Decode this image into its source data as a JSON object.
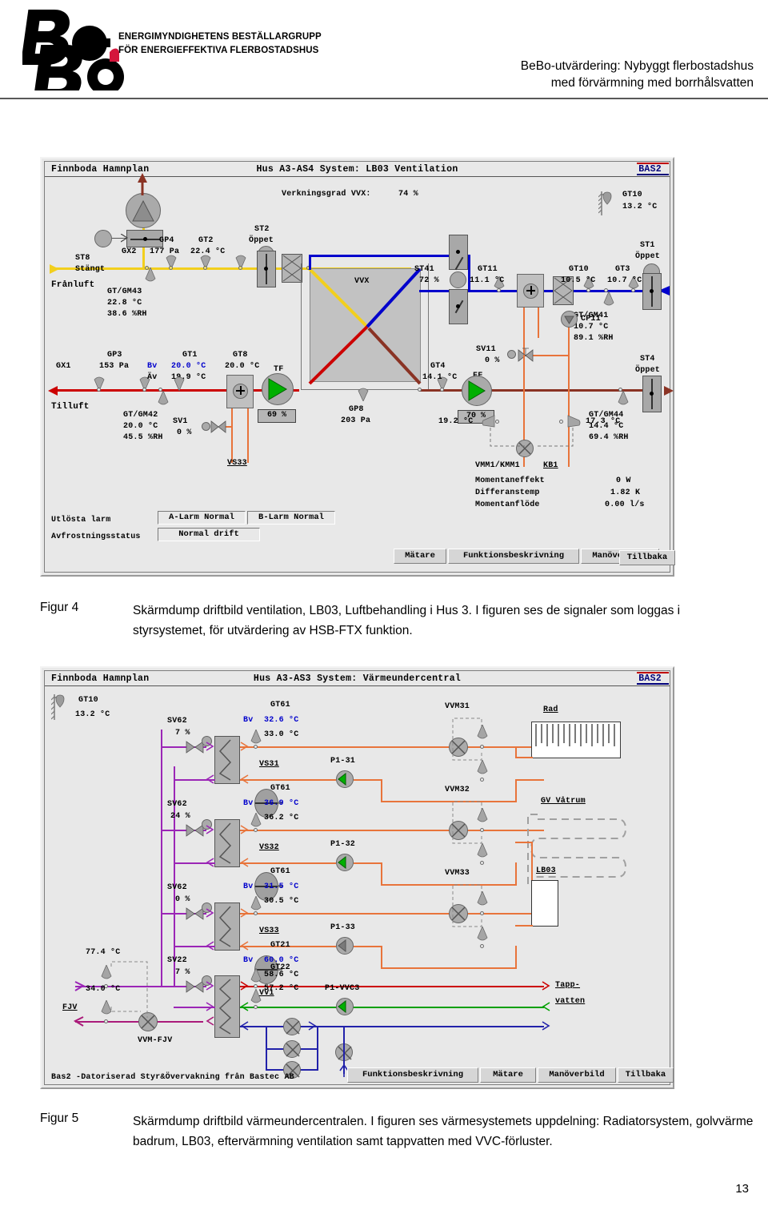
{
  "header": {
    "logo_line1": "ENERGIMYNDIGHETENS BESTÄLLARGRUPP",
    "logo_line2": "FÖR ENERGIEFFEKTIVA FLERBOSTADSHUS",
    "title_line1": "BeBo-utvärdering: Nybyggt flerbostadshus",
    "title_line2": "med förvärmning med borrhålsvatten"
  },
  "fig4": {
    "caption_label": "Figur 4",
    "caption_line1": "Skärmdump driftbild ventilation, LB03, Luftbehandling i Hus 3. I figuren ses de",
    "caption_line2": "signaler som loggas i styrsystemet, för utvärdering av HSB-FTX funktion."
  },
  "fig5": {
    "caption_label": "Figur 5",
    "caption_line1": "Skärmdump driftbild värmeundercentralen. I figuren ses värmesystemets",
    "caption_line2": "uppdelning: Radiatorsystem, golvvärme badrum, LB03, eftervärmning ventilation",
    "caption_line3": "samt tappvatten med VVC-förluster."
  },
  "page_number": "13",
  "panel1": {
    "title_left": "Finnboda Hamnplan",
    "title_mid": "Hus A3-AS4 System: LB03 Ventilation",
    "bas2": "BAS2",
    "efficiency_label": "Verkningsgrad VVX:",
    "efficiency_value": "74 %",
    "vvx_label": "VVX",
    "labels": {
      "st8": "ST8",
      "st8_state": "Stängt",
      "franluft": "Frånluft",
      "tilluft": "Tilluft",
      "gx2": "GX2",
      "gx1": "GX1",
      "gp4": "GP4",
      "gp4_val": "177 Pa",
      "gt2": "GT2",
      "gt2_val": "22.4 °C",
      "st2": "ST2",
      "st2_state": "Öppet",
      "gtgm43": "GT/GM43",
      "gtgm43_t": "22.8 °C",
      "gtgm43_rh": "38.6 %RH",
      "gp3": "GP3",
      "gp3_val": "153 Pa",
      "bv": "Bv",
      "av": "Äv",
      "gt1": "GT1",
      "gt1_bv": "20.0 °C",
      "gt1_av": "19.9 °C",
      "gt8": "GT8",
      "gt8_val": "20.0 °C",
      "tf": "TF",
      "tf_pct": "69 %",
      "gtgm42": "GT/GM42",
      "gtgm42_t": "20.0 °C",
      "gtgm42_rh": "45.5 %RH",
      "sv1": "SV1",
      "sv1_val": "0 %",
      "vs33": "VS33",
      "gp8": "GP8",
      "gp8_val": "203 Pa",
      "st41": "ST41",
      "st41_val": "72 %",
      "gt4": "GT4",
      "gt4_val": "14.1 °C",
      "ff": "FF",
      "ff_pct": "70 %",
      "gt11": "GT11",
      "gt11_val": "11.1 °C",
      "gt10b": "GT10",
      "gt10b_val": "10.5 °C",
      "gt3": "GT3",
      "gt3_val": "10.7 °C",
      "gt10_out": "GT10",
      "gt10_out_val": "13.2 °C",
      "st1": "ST1",
      "st1_state": "Öppet",
      "st4": "ST4",
      "st4_state": "Öppet",
      "sv11": "SV11",
      "sv11_val": "0 %",
      "cp11": "CP11",
      "gtgm41": "GT/GM41",
      "gtgm41_t": "10.7 °C",
      "gtgm41_rh": "89.1 %RH",
      "gtgm44": "GT/GM44",
      "gtgm44_t": "14.4 °C",
      "gtgm44_rh": "69.4 %RH",
      "t192": "19.2 °C",
      "t173": "17.3 °C",
      "vmm1": "VMM1/KMM1",
      "kb1": "KB1"
    },
    "meter": {
      "row1_label": "Momentaneffekt",
      "row1_value": "0 W",
      "row2_label": "Differanstemp",
      "row2_value": "1.82 K",
      "row3_label": "Momentanflöde",
      "row3_value": "0.00 l/s"
    },
    "alarms": {
      "utlosta_label": "Utlösta larm",
      "a_larm": "A-Larm Normal",
      "b_larm": "B-Larm Normal",
      "avfrost_label": "Avfrostningsstatus",
      "avfrost_value": "Normal drift"
    },
    "buttons": [
      "Mätare",
      "Funktionsbeskrivning",
      "Manöverbild",
      "Tillbaka"
    ]
  },
  "panel2": {
    "title_left": "Finnboda Hamnplan",
    "title_mid": "Hus A3-AS3 System: Värmeundercentral",
    "bas2": "BAS2",
    "footer_text": "Bas2 -Datoriserad Styr&Övervakning från Bastec AB",
    "labels": {
      "gt10": "GT10",
      "gt10_val": "13.2 °C",
      "sv62a": "SV62",
      "sv62a_val": "7 %",
      "sv62b": "SV62",
      "sv62b_val": "24 %",
      "sv62c": "SV62",
      "sv62c_val": "0 %",
      "sv22": "SV22",
      "sv22_val": "7 %",
      "gt61a": "GT61",
      "gt61a_bv": "32.6 °C",
      "gt61a_av": "33.0 °C",
      "gt61b": "GT61",
      "gt61b_bv": "36.9 °C",
      "gt61b_av": "36.2 °C",
      "gt61c": "GT61",
      "gt61c_bv": "31.5 °C",
      "gt61c_av": "30.5 °C",
      "gt21": "GT21",
      "gt21_bv": "60.0 °C",
      "gt21_av": "58.6 °C",
      "gt22": "GT22",
      "gt22_val": "57.2 °C",
      "bv": "Bv",
      "p131": "P1-31",
      "p132": "P1-32",
      "p133": "P1-33",
      "p1vvc3": "P1-VVC3",
      "vs31": "VS31",
      "vs32": "VS32",
      "vs33": "VS33",
      "vv1": "VV1",
      "vvm31": "VVM31",
      "vvm32": "VVM32",
      "vvm33": "VVM33",
      "vvmfjv": "VVM-FJV",
      "rad": "Rad",
      "gv_vatrum": "GV Våtrum",
      "lb03": "LB03",
      "tapp1": "Tapp-",
      "tapp2": "vatten",
      "fjv": "FJV",
      "t774": "77.4 °C",
      "t340": "34.0 °C"
    },
    "buttons": [
      "Funktionsbeskrivning",
      "Mätare",
      "Manöverbild",
      "Tillbaka"
    ]
  },
  "colors": {
    "yellow": "#f2cf1d",
    "red": "#cc0000",
    "blue": "#0000cc",
    "brown": "#8a3324",
    "orange": "#e8743b",
    "purple": "#9b26b6",
    "magenta": "#aa1a7a",
    "green": "#00a000",
    "navy": "#2222aa",
    "panel_bg": "#e8e8e8"
  }
}
